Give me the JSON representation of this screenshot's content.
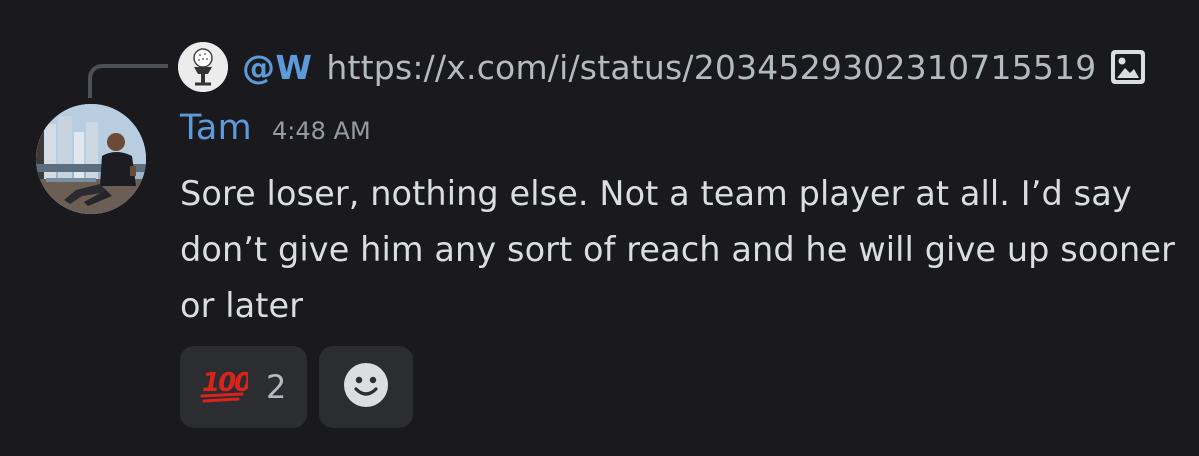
{
  "reply": {
    "author": "@W",
    "content": "https://x.com/i/status/2034529302310715519",
    "avatar_icon": "golf-ball-icon",
    "attachment_icon": "image-icon"
  },
  "message": {
    "username": "Tam",
    "timestamp": "4:48 AM",
    "text": "Sore loser, nothing else. Not a team player at all. I’d say don’t give him any sort of reach and he will give up sooner or later",
    "user_color": "#5b9bd9"
  },
  "reactions": [
    {
      "emoji": "💯",
      "emoji_text": "100",
      "count": "2"
    }
  ],
  "add_reaction_icon": "smiley-icon",
  "colors": {
    "background": "#1a1a1e",
    "text": "#dbdee1",
    "muted": "#949ba4",
    "reaction_bg": "#2b2d31",
    "emoji_red": "#d9241c"
  }
}
